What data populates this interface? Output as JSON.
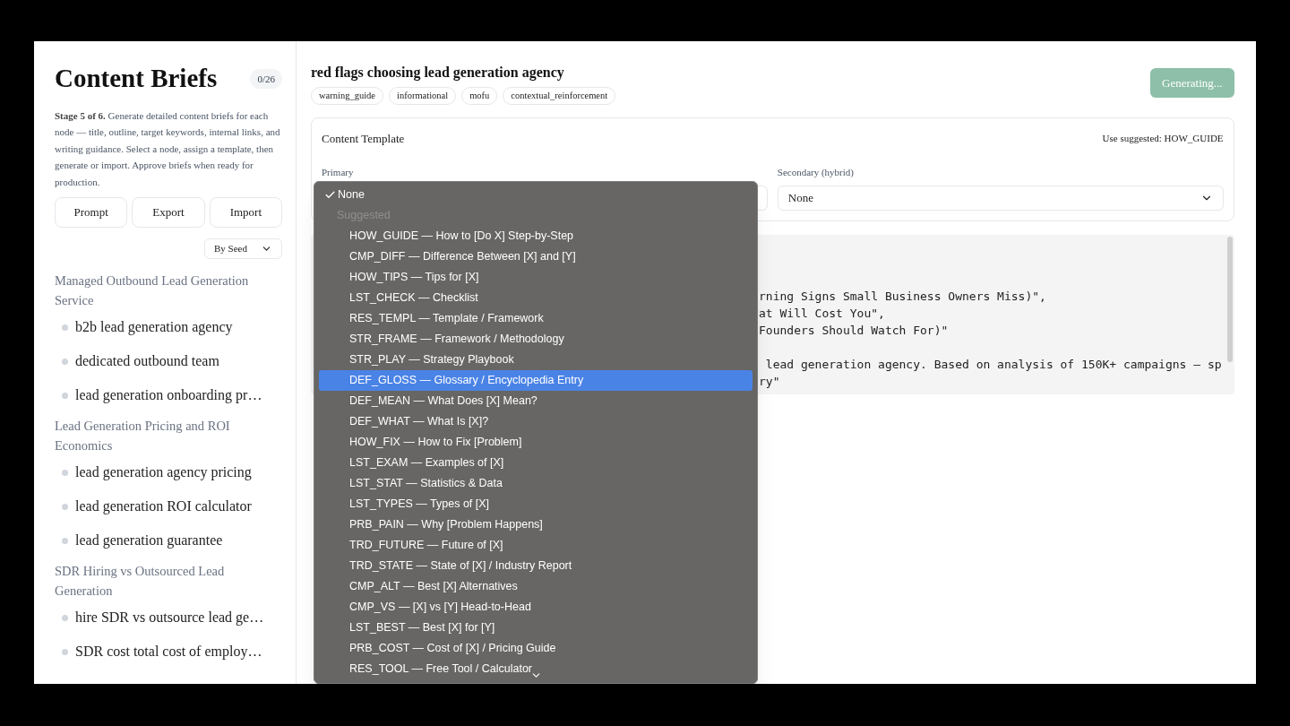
{
  "sidebar": {
    "title": "Content Briefs",
    "count": "0/26",
    "description": "**Stage 5 of 6.** Generate detailed content briefs for each node — title, outline, target keywords, internal links, and writing guidance. Select a node, assign a template, then generate or import. Approve briefs when ready for production.",
    "buttons": [
      "Prompt",
      "Export",
      "Import"
    ],
    "sort": {
      "value": "By Seed"
    },
    "groups": [
      {
        "title": "Managed Outbound Lead Generation Service",
        "items": [
          {
            "label": "b2b lead generation agency"
          },
          {
            "label": "dedicated outbound team"
          },
          {
            "label": "lead generation onboarding pr…"
          }
        ]
      },
      {
        "title": "Lead Generation Pricing and ROI Economics",
        "items": [
          {
            "label": "lead generation agency pricing"
          },
          {
            "label": "lead generation ROI calculator"
          },
          {
            "label": "lead generation guarantee"
          }
        ]
      },
      {
        "title": "SDR Hiring vs Outsourced Lead Generation",
        "items": [
          {
            "label": "hire SDR vs outsource lead ge…"
          },
          {
            "label": "SDR cost total cost of employ…"
          }
        ]
      }
    ]
  },
  "brief": {
    "title": "red flags choosing lead generation agency",
    "tags": [
      "warning_guide",
      "informational",
      "mofu",
      "contextual_reinforcement"
    ],
    "action": {
      "label": "Generating...",
      "disabled": true
    }
  },
  "template": {
    "title": "Content Template",
    "suggestion": "Use suggested: HOW_GUIDE",
    "primary": {
      "label": "Primary"
    },
    "secondary": {
      "label": "Secondary (hybrid)",
      "value": "None"
    }
  },
  "code_blocks": [
    [
      "rning Signs Small Business Owners Miss)\",",
      "at Will Cost You\",",
      "Founders Should Watch For)\""
    ],
    [
      " lead generation agency. Based on analysis of 150K+ campaigns — sp",
      "ry\""
    ]
  ],
  "dropdown": {
    "options": [
      {
        "kind": "option",
        "label": "None",
        "checked": true,
        "selected": false
      },
      {
        "kind": "header",
        "label": "Suggested"
      },
      {
        "kind": "option",
        "label": "HOW_GUIDE — How to [Do X] Step-by-Step",
        "checked": false,
        "selected": false
      },
      {
        "kind": "option",
        "label": "CMP_DIFF — Difference Between [X] and [Y]",
        "checked": false,
        "selected": false
      },
      {
        "kind": "option",
        "label": "HOW_TIPS — Tips for [X]",
        "checked": false,
        "selected": false
      },
      {
        "kind": "option",
        "label": "LST_CHECK — Checklist",
        "checked": false,
        "selected": false
      },
      {
        "kind": "option",
        "label": "RES_TEMPL — Template / Framework",
        "checked": false,
        "selected": false
      },
      {
        "kind": "option",
        "label": "STR_FRAME — Framework / Methodology",
        "checked": false,
        "selected": false
      },
      {
        "kind": "option",
        "label": "STR_PLAY — Strategy Playbook",
        "checked": false,
        "selected": false
      },
      {
        "kind": "option",
        "label": "DEF_GLOSS — Glossary / Encyclopedia Entry",
        "checked": false,
        "selected": true
      },
      {
        "kind": "option",
        "label": "DEF_MEAN — What Does [X] Mean?",
        "checked": false,
        "selected": false
      },
      {
        "kind": "option",
        "label": "DEF_WHAT — What Is [X]?",
        "checked": false,
        "selected": false
      },
      {
        "kind": "option",
        "label": "HOW_FIX — How to Fix [Problem]",
        "checked": false,
        "selected": false
      },
      {
        "kind": "option",
        "label": "LST_EXAM — Examples of [X]",
        "checked": false,
        "selected": false
      },
      {
        "kind": "option",
        "label": "LST_STAT — Statistics & Data",
        "checked": false,
        "selected": false
      },
      {
        "kind": "option",
        "label": "LST_TYPES — Types of [X]",
        "checked": false,
        "selected": false
      },
      {
        "kind": "option",
        "label": "PRB_PAIN — Why [Problem Happens]",
        "checked": false,
        "selected": false
      },
      {
        "kind": "option",
        "label": "TRD_FUTURE — Future of [X]",
        "checked": false,
        "selected": false
      },
      {
        "kind": "option",
        "label": "TRD_STATE — State of [X] / Industry Report",
        "checked": false,
        "selected": false
      },
      {
        "kind": "option",
        "label": "CMP_ALT — Best [X] Alternatives",
        "checked": false,
        "selected": false
      },
      {
        "kind": "option",
        "label": "CMP_VS — [X] vs [Y] Head-to-Head",
        "checked": false,
        "selected": false
      },
      {
        "kind": "option",
        "label": "LST_BEST — Best [X] for [Y]",
        "checked": false,
        "selected": false
      },
      {
        "kind": "option",
        "label": "PRB_COST — Cost of [X] / Pricing Guide",
        "checked": false,
        "selected": false
      },
      {
        "kind": "option",
        "label": "RES_TOOL — Free Tool / Calculator",
        "checked": false,
        "selected": false
      }
    ]
  }
}
